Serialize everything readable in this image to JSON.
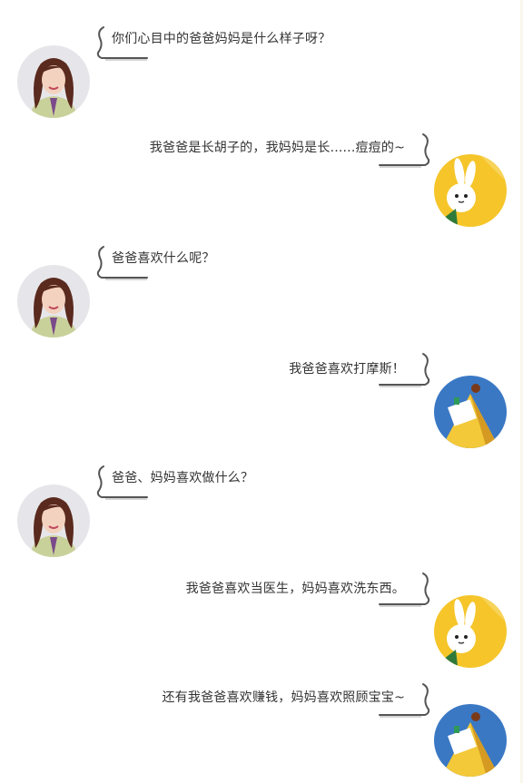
{
  "messages": [
    {
      "side": "left",
      "avatar": "woman-portrait-icon",
      "text": "你们心目中的爸爸妈妈是什么样子呀？"
    },
    {
      "side": "right",
      "avatar": "rabbit-icon",
      "text": "我爸爸是长胡子的，我妈妈是长......痘痘的~"
    },
    {
      "side": "left",
      "avatar": "woman-portrait-icon",
      "text": "爸爸喜欢什么呢？"
    },
    {
      "side": "right",
      "avatar": "book-tent-icon",
      "text": "我爸爸喜欢打摩斯！"
    },
    {
      "side": "left",
      "avatar": "woman-portrait-icon",
      "text": "爸爸、妈妈喜欢做什么？"
    },
    {
      "side": "right",
      "avatar": "rabbit-icon",
      "text": "我爸爸喜欢当医生，妈妈喜欢洗东西。"
    },
    {
      "side": "right",
      "avatar": "book-tent-icon",
      "text": "还有我爸爸喜欢赚钱，妈妈喜欢照顾宝宝~"
    }
  ],
  "colors": {
    "text": "#333333",
    "bracket": "#555555",
    "rabbit_bg": "#f5c52a",
    "book_bg": "#3a78c4",
    "woman_bg": "#e6e6ea"
  }
}
